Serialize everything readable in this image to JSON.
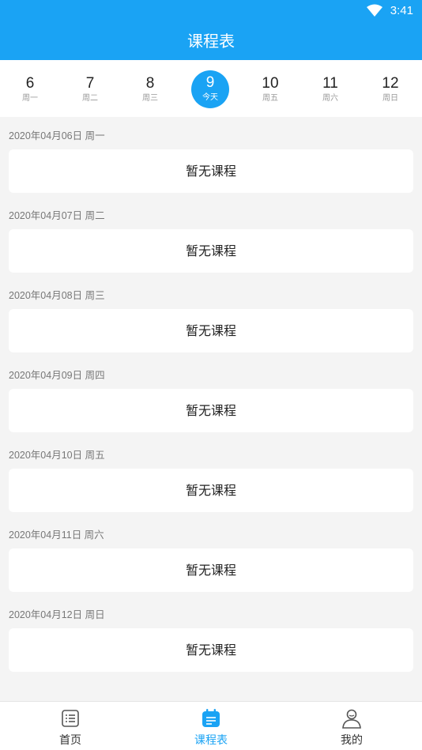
{
  "status": {
    "time": "3:41"
  },
  "header": {
    "title": "课程表"
  },
  "week": [
    {
      "num": "6",
      "label": "周一"
    },
    {
      "num": "7",
      "label": "周二"
    },
    {
      "num": "8",
      "label": "周三"
    },
    {
      "num": "9",
      "label": "今天"
    },
    {
      "num": "10",
      "label": "周五"
    },
    {
      "num": "11",
      "label": "周六"
    },
    {
      "num": "12",
      "label": "周日"
    }
  ],
  "schedule": [
    {
      "date": "2020年04月06日 周一",
      "content": "暂无课程"
    },
    {
      "date": "2020年04月07日 周二",
      "content": "暂无课程"
    },
    {
      "date": "2020年04月08日 周三",
      "content": "暂无课程"
    },
    {
      "date": "2020年04月09日 周四",
      "content": "暂无课程"
    },
    {
      "date": "2020年04月10日 周五",
      "content": "暂无课程"
    },
    {
      "date": "2020年04月11日 周六",
      "content": "暂无课程"
    },
    {
      "date": "2020年04月12日 周日",
      "content": "暂无课程"
    }
  ],
  "tabs": [
    {
      "label": "首页",
      "icon": "list-icon"
    },
    {
      "label": "课程表",
      "icon": "calendar-icon"
    },
    {
      "label": "我的",
      "icon": "user-icon"
    }
  ],
  "colors": {
    "accent": "#1aa3f4"
  }
}
